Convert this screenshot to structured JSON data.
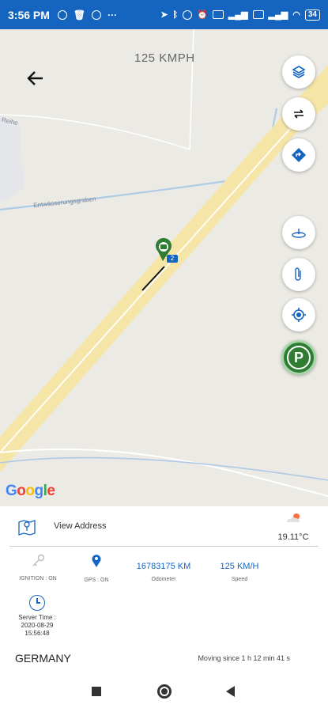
{
  "status_bar": {
    "time": "3:56 PM",
    "battery": "34",
    "icons_left": [
      "whatsapp-icon",
      "trash-icon",
      "messenger-icon",
      "more-icon"
    ],
    "icons_right": [
      "location-icon",
      "bluetooth-icon",
      "eye-icon",
      "alarm-icon",
      "vowifi-icon",
      "signal-icon",
      "volte-icon",
      "signal-icon",
      "wifi-icon",
      "battery-icon"
    ],
    "color": "#1565c0"
  },
  "map": {
    "speed_label": "125 KMPH",
    "street_labels": [
      "Reihe",
      "Entwässerungsgraben"
    ],
    "google_logo": [
      "G",
      "o",
      "o",
      "g",
      "l",
      "e"
    ],
    "vehicle_badge": "2",
    "controls": [
      "layers-icon",
      "swap-icon",
      "directions-icon",
      "geofence-icon",
      "attachment-icon",
      "my-location-icon",
      "parking-icon"
    ],
    "parking_label": "P"
  },
  "panel": {
    "view_address": "View Address",
    "temperature": "19.11°C",
    "ignition": {
      "label": "IGNITION : ON"
    },
    "gps": {
      "label": "GPS : ON"
    },
    "odometer": {
      "value": "16783175 KM",
      "label": "Odometer"
    },
    "speed": {
      "value": "125 KM/H",
      "label": "Speed"
    },
    "server_time": {
      "label": "Server Time :",
      "date": "2020-08-29",
      "time": "15:56:48"
    },
    "country": "GERMANY",
    "moving_since": "Moving since 1 h 12 min 41 s"
  }
}
